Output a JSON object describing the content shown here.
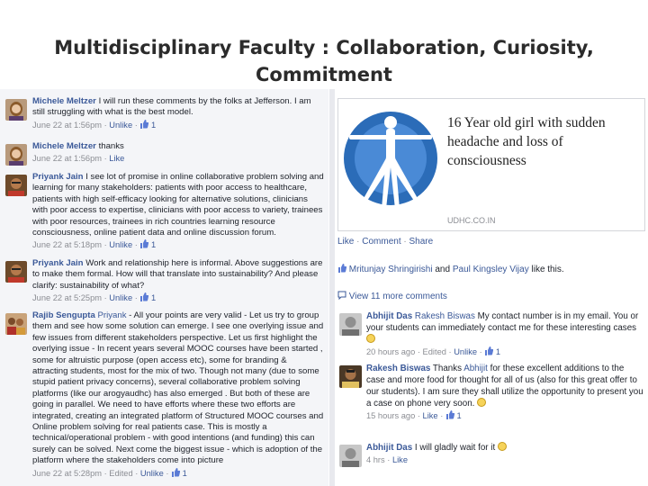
{
  "slide": {
    "title_line1": "Multidisciplinary Faculty : Collaboration, Curiosity,",
    "title_line2": "Commitment"
  },
  "left_comments": [
    {
      "author": "Michele Meltzer",
      "text": " I will run these comments by the folks at Jefferson. I am still struggling with what is the best model.",
      "time": "June 22 at 1:56pm",
      "action": "Unlike",
      "likes": "1"
    },
    {
      "author": "Michele Meltzer",
      "text": " thanks",
      "time": "June 22 at 1:56pm",
      "action": "Like"
    },
    {
      "author": "Priyank Jain",
      "text": " I see lot of promise in online collaborative problem solving and learning for many stakeholders: patients with poor access to healthcare, patients with high self-efficacy looking for alternative solutions, clinicians with poor access to expertise, clinicians with poor access to variety, trainees with poor resources, trainees in rich countries learning resource consciousness, online patient data and online discussion forum.",
      "time": "June 22 at 5:18pm",
      "action": "Unlike",
      "likes": "1"
    },
    {
      "author": "Priyank Jain",
      "text": " Work and relationship here is informal. Above suggestions are to make them formal. How will that translate into sustainability? And please clarify: sustainability of what?",
      "time": "June 22 at 5:25pm",
      "action": "Unlike",
      "likes": "1"
    },
    {
      "author": "Rajib Sengupta",
      "mention": "Priyank",
      "text": " - All your points are very valid - Let us try to group them and see how some solution can emerge. I see one overlying issue and few issues from different stakeholders perspective. Let us first highlight the overlying issue - In recent years several MOOC courses have been started , some for altruistic purpose (open access etc), some for branding & attracting students, most for the mix of two. Though not many (due to some stupid patient privacy concerns), several collaborative problem solving platforms (like our arogyaudhc) has also emerged . But both of these are going in parallel. We need to have efforts where these two efforts are integrated, creating an integrated platform of Structured MOOC courses and Online problem solving for real patients case. This is mostly a technical/operational problem - with good intentions (and funding) this can surely can be solved. Next come the biggest issue - which is adoption of the platform where the stakeholders come into picture",
      "time": "June 22 at 5:28pm",
      "edited": "Edited",
      "action": "Unlike",
      "likes": "1"
    }
  ],
  "shared_post": {
    "title": "16 Year old girl with sudden headache and loss of consciousness",
    "domain": "UDHC.CO.IN",
    "actions": [
      "Like",
      "Comment",
      "Share"
    ],
    "liked_by_1": "Mritunjay Shringirishi",
    "liked_by_and": " and ",
    "liked_by_2": "Paul Kingsley Vijay",
    "liked_by_suffix": " like this.",
    "view_more": "View 11 more comments"
  },
  "right_comments": [
    {
      "author": "Abhijit Das",
      "mention": "Rakesh Biswas",
      "text": " My contact number is in my email. You or your students can immediately contact me for these interesting cases ",
      "time": "20 hours ago",
      "edited": "Edited",
      "action": "Unlike",
      "likes": "1"
    },
    {
      "author": "Rakesh Biswas",
      "text_pre": " Thanks ",
      "mention": "Abhijit",
      "text": " for these excellent additions to the case and more food for thought for all of us (also for this great offer to our students). I am sure they shall utilize the opportunity to present you a case on phone very soon. ",
      "time": "15 hours ago",
      "action": "Like",
      "likes": "1"
    },
    {
      "author": "Abhijit Das",
      "text": " I will gladly wait for it ",
      "time": "4 hrs",
      "action": "Like"
    }
  ],
  "meta_separator": " · ",
  "icons": [
    "like-thumb-icon",
    "smiley-icon",
    "speech-bubble-icon",
    "vitruvian-man-icon"
  ],
  "colors": {
    "link": "#3b5998",
    "meta": "#8b8d93",
    "logo_blue": "#2b6cb8"
  }
}
